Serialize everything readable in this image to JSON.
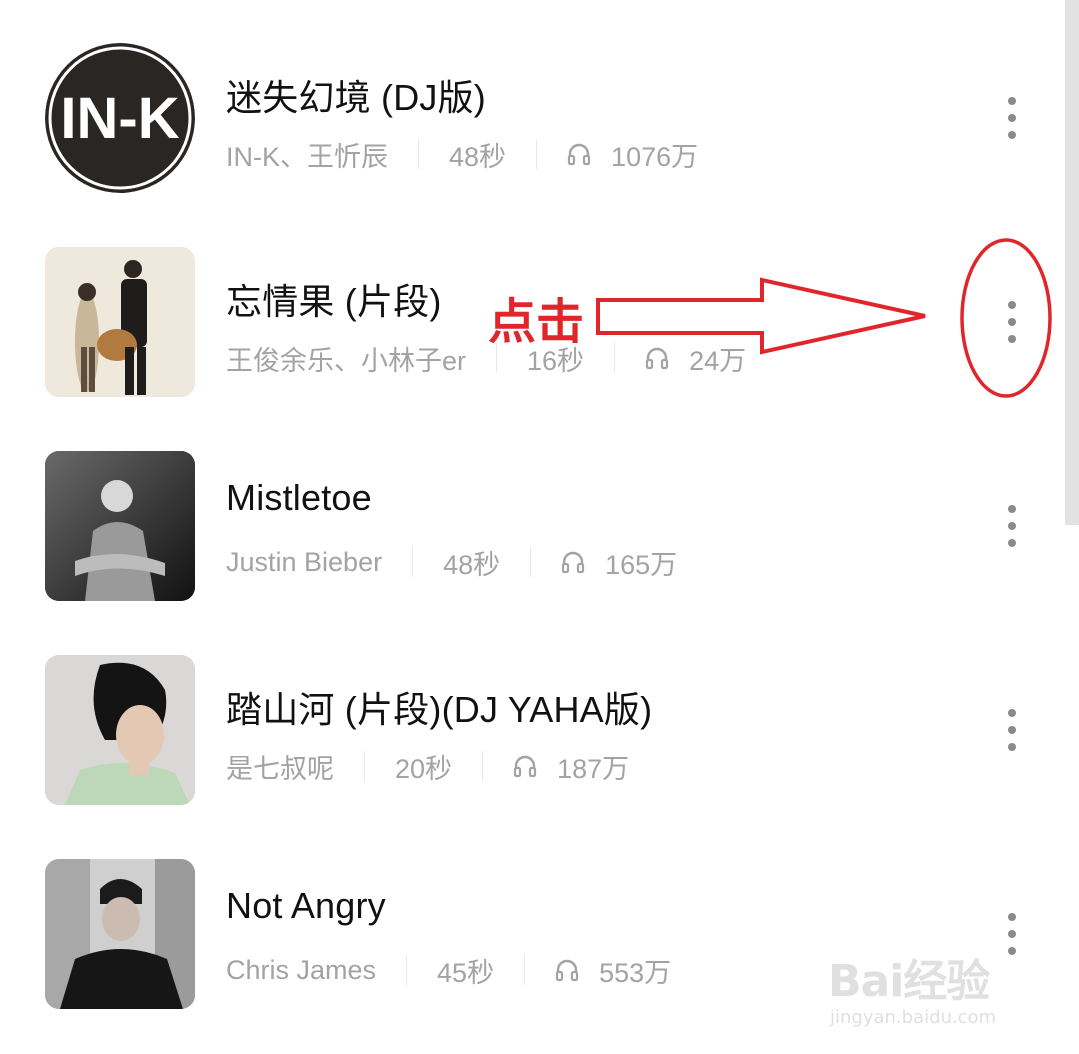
{
  "songs": [
    {
      "title": "迷失幻境 (DJ版)",
      "artist": "IN-K、王忻辰",
      "duration": "48秒",
      "plays": "1076万",
      "cover_logo": "IN-K"
    },
    {
      "title": "忘情果 (片段)",
      "artist": "王俊余乐、小林子er",
      "duration": "16秒",
      "plays": "24万"
    },
    {
      "title": "Mistletoe",
      "artist": "Justin Bieber",
      "duration": "48秒",
      "plays": "165万"
    },
    {
      "title": "踏山河 (片段)(DJ YAHA版)",
      "artist": "是七叔呢",
      "duration": "20秒",
      "plays": "187万"
    },
    {
      "title": "Not Angry",
      "artist": "Chris James",
      "duration": "45秒",
      "plays": "553万"
    }
  ],
  "annotation": {
    "text": "点击",
    "color": "#e0262b"
  },
  "icons": {
    "plays": "headphones-icon",
    "more": "more-vertical-icon"
  },
  "watermark": {
    "main": "Bai经验",
    "sub": "jingyan.baidu.com"
  }
}
